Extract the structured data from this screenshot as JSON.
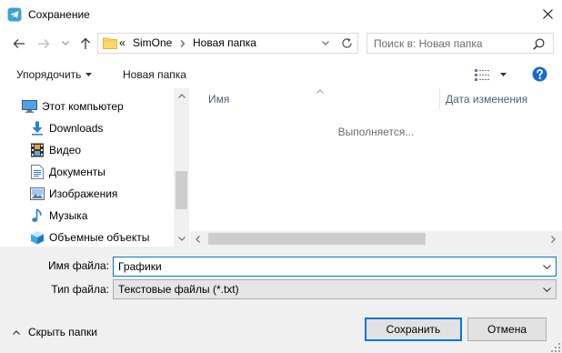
{
  "window": {
    "title": "Сохранение"
  },
  "nav": {
    "address": {
      "overflow": "«",
      "segments": [
        "SimOne",
        "Новая папка"
      ]
    },
    "search_placeholder": "Поиск в: Новая папка"
  },
  "toolbar": {
    "organize_label": "Упорядочить",
    "new_folder_label": "Новая папка"
  },
  "sidebar": {
    "items": [
      {
        "label": "Этот компьютер",
        "icon": "computer-icon"
      },
      {
        "label": "Downloads",
        "icon": "downloads-icon"
      },
      {
        "label": "Видео",
        "icon": "videos-icon"
      },
      {
        "label": "Документы",
        "icon": "documents-icon"
      },
      {
        "label": "Изображения",
        "icon": "pictures-icon"
      },
      {
        "label": "Музыка",
        "icon": "music-icon"
      },
      {
        "label": "Объемные объекты",
        "icon": "3d-objects-icon"
      }
    ]
  },
  "file_list": {
    "columns": [
      {
        "label": "Имя",
        "sort_icon": "sort-ascending-icon"
      },
      {
        "label": "Дата изменения"
      }
    ],
    "status": "Выполняется..."
  },
  "form": {
    "filename_label": "Имя файла:",
    "filename_value": "Графики",
    "filetype_label": "Тип файла:",
    "filetype_value": "Текстовые файлы (*.txt)"
  },
  "footer": {
    "hide_folders_label": "Скрыть папки",
    "save_label": "Сохранить",
    "cancel_label": "Отмена"
  },
  "colors": {
    "accent": "#0078d7",
    "panel": "#f0f0f0",
    "header_text": "#4c607a",
    "muted_text": "#6d6d6d",
    "button_face": "#e1e1e1",
    "button_border": "#adadad",
    "scroll_thumb": "#cdcdcd",
    "help": "#1a6ac9"
  }
}
